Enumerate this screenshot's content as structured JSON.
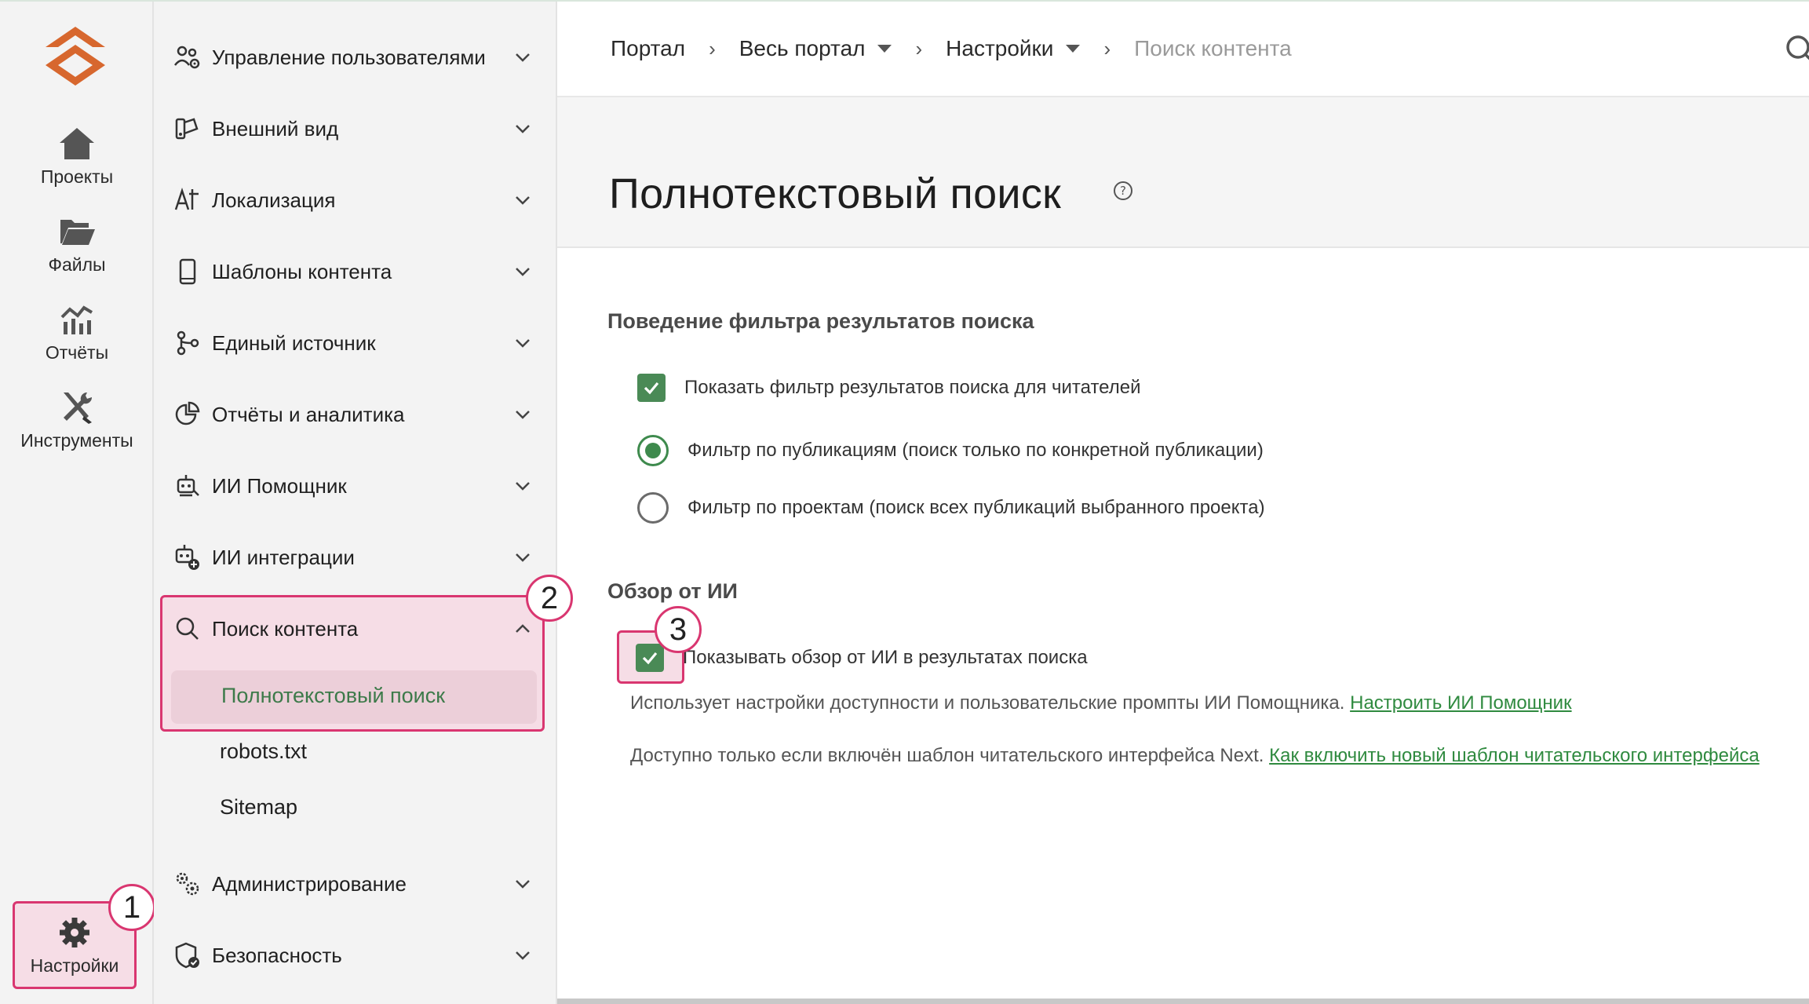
{
  "colors": {
    "accent": "#3e8a4d",
    "highlight": "#d93670",
    "brand": "#d7672e"
  },
  "rail": {
    "items": [
      {
        "label": "Проекты",
        "icon": "home-icon"
      },
      {
        "label": "Файлы",
        "icon": "folder-icon"
      },
      {
        "label": "Отчёты",
        "icon": "chart-icon"
      },
      {
        "label": "Инструменты",
        "icon": "tools-icon"
      }
    ],
    "settings": {
      "label": "Настройки",
      "icon": "gear-icon"
    }
  },
  "nav": {
    "items": [
      {
        "label": "Управление пользователями",
        "icon": "users-gear-icon"
      },
      {
        "label": "Внешний вид",
        "icon": "palette-icon"
      },
      {
        "label": "Локализация",
        "icon": "translate-icon"
      },
      {
        "label": "Шаблоны контента",
        "icon": "tablet-icon"
      },
      {
        "label": "Единый источник",
        "icon": "branch-icon"
      },
      {
        "label": "Отчёты и аналитика",
        "icon": "pie-chart-icon"
      },
      {
        "label": "ИИ Помощник",
        "icon": "robot-icon"
      },
      {
        "label": "ИИ интеграции",
        "icon": "robot-plus-icon"
      },
      {
        "label": "Поиск контента",
        "icon": "search-icon"
      },
      {
        "label": "Администрирование",
        "icon": "gears-icon"
      },
      {
        "label": "Безопасность",
        "icon": "shield-icon"
      }
    ],
    "sub": {
      "active": "Полнотекстовый поиск",
      "robots": "robots.txt",
      "sitemap": "Sitemap"
    }
  },
  "badges": [
    "1",
    "2",
    "3"
  ],
  "breadcrumb": {
    "portal": "Портал",
    "all": "Весь портал",
    "settings": "Настройки",
    "current": "Поиск контента"
  },
  "page": {
    "title": "Полнотекстовый поиск",
    "section1": {
      "title": "Поведение фильтра результатов поиска",
      "show_filter": "Показать фильтр результатов поиска для читателей",
      "radio_pub": "Фильтр по публикациям (поиск только по конкретной публикации)",
      "radio_proj": "Фильтр по проектам (поиск всех публикаций выбранного проекта)"
    },
    "section2": {
      "title": "Обзор от ИИ",
      "show_ai": "Показывать обзор от ИИ в результатах поиска",
      "note1_text": "Использует настройки доступности и пользовательские промпты ИИ Помощника.",
      "note1_link": "Настроить ИИ Помощник",
      "note2_text": "Доступно только если включён шаблон читательского интерфейса Next.",
      "note2_link": "Как включить новый шаблон читательского интерфейса"
    }
  }
}
